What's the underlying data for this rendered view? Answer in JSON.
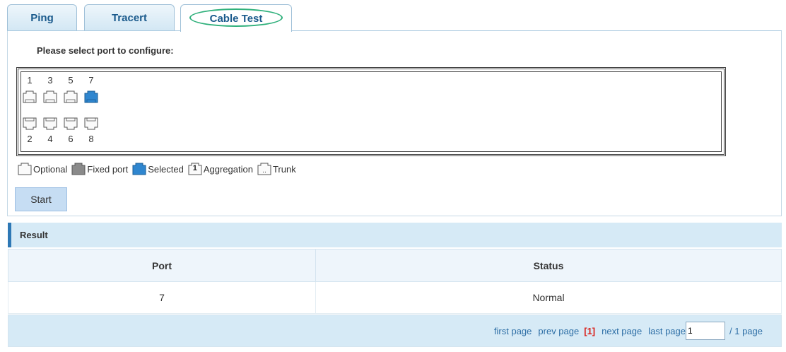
{
  "tabs": [
    {
      "label": "Ping"
    },
    {
      "label": "Tracert"
    },
    {
      "label": "Cable Test"
    }
  ],
  "config": {
    "prompt": "Please select port to configure:",
    "top_ports": [
      "1",
      "3",
      "5",
      "7"
    ],
    "bottom_ports": [
      "2",
      "4",
      "6",
      "8"
    ],
    "selected_port": "7"
  },
  "legend": {
    "optional": "Optional",
    "fixed": "Fixed port",
    "selected": "Selected",
    "aggregation": "Aggregation",
    "aggregation_badge": "1",
    "trunk": "Trunk"
  },
  "start_label": "Start",
  "result": {
    "title": "Result",
    "columns": [
      "Port",
      "Status"
    ],
    "rows": [
      [
        "7",
        "Normal"
      ]
    ]
  },
  "pager": {
    "first": "first page",
    "prev": "prev page",
    "current": "[1]",
    "next": "next page",
    "last": "last page",
    "input_value": "1",
    "total": "/ 1 page"
  },
  "colors": {
    "accent": "#2e78b5",
    "selected_port": "#2f86cf",
    "fixed_port": "#8a8a8a",
    "tab_highlight": "#2fb07b",
    "current_page": "#d9221c"
  }
}
